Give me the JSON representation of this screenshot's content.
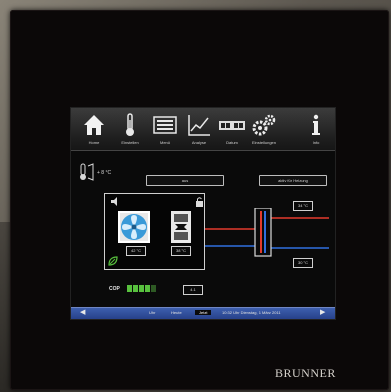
{
  "toolbar": {
    "items": [
      {
        "label": "Home",
        "icon": "home-icon"
      },
      {
        "label": "Einstellen",
        "icon": "thermometer-icon"
      },
      {
        "label": "Menü",
        "icon": "menu-icon"
      },
      {
        "label": "Analyse",
        "icon": "chart-icon"
      },
      {
        "label": "Datum",
        "icon": "clock-icon"
      },
      {
        "label": "Einstellungen",
        "icon": "gears-icon"
      },
      {
        "label": "Info",
        "icon": "info-icon"
      }
    ]
  },
  "status": {
    "outside_temp": "+ 8 °C",
    "mode_left": "aus",
    "mode_right": "aktiv für Heizung"
  },
  "heatpump": {
    "fan_value": "42 °C",
    "compressor_value": "38 °C",
    "flow_temp": "34 °C",
    "return_temp": "30 °C"
  },
  "cop": {
    "label": "COP",
    "value": "4.1",
    "bars_total": 5,
    "bars_active": 4
  },
  "timebar": {
    "times": [
      "Uhr",
      "Heute",
      "Jetzt"
    ],
    "active_index": 2,
    "date_text": "10:32 Uhr Dienstag, 1 März 2011"
  },
  "brand": "BRUNNER",
  "colors": {
    "supply": "#e33a2c",
    "return": "#2f6fe0",
    "cop": "#58c13e",
    "fan": "#3a9ad8"
  }
}
